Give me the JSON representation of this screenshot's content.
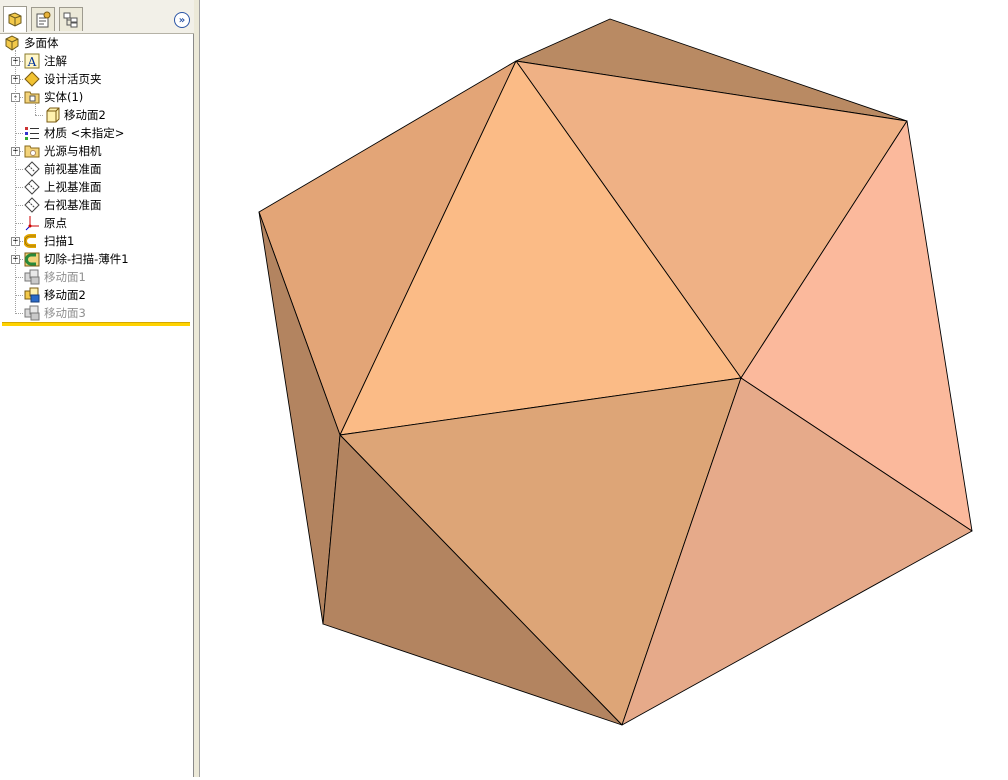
{
  "feature_tree": {
    "tabs": [
      {
        "name": "featuremanager-tab-icon",
        "active": true
      },
      {
        "name": "propertymanager-tab-icon",
        "active": false
      },
      {
        "name": "configurationmanager-tab-icon",
        "active": false
      }
    ],
    "expand_button": "»",
    "items": [
      {
        "label": "多面体",
        "icon": "part-icon",
        "level": 0,
        "expander": "",
        "dim": false
      },
      {
        "label": "注解",
        "icon": "annotations-icon",
        "level": 1,
        "expander": "+",
        "dim": false
      },
      {
        "label": "设计活页夹",
        "icon": "design-binder-icon",
        "level": 1,
        "expander": "+",
        "dim": false
      },
      {
        "label": "实体(1)",
        "icon": "solid-bodies-icon",
        "level": 1,
        "expander": "-",
        "dim": false
      },
      {
        "label": "移动面2",
        "icon": "body-icon",
        "level": 2,
        "expander": "",
        "dim": false
      },
      {
        "label": "材质 <未指定>",
        "icon": "material-icon",
        "level": 1,
        "expander": "",
        "dim": false
      },
      {
        "label": "光源与相机",
        "icon": "lights-cameras-icon",
        "level": 1,
        "expander": "+",
        "dim": false
      },
      {
        "label": "前视基准面",
        "icon": "plane-icon",
        "level": 1,
        "expander": "",
        "dim": false
      },
      {
        "label": "上视基准面",
        "icon": "plane-icon",
        "level": 1,
        "expander": "",
        "dim": false
      },
      {
        "label": "右视基准面",
        "icon": "plane-icon",
        "level": 1,
        "expander": "",
        "dim": false
      },
      {
        "label": "原点",
        "icon": "origin-icon",
        "level": 1,
        "expander": "",
        "dim": false
      },
      {
        "label": "扫描1",
        "icon": "sweep-icon",
        "level": 1,
        "expander": "+",
        "dim": false
      },
      {
        "label": "切除-扫描-薄件1",
        "icon": "cut-sweep-icon",
        "level": 1,
        "expander": "+",
        "dim": false
      },
      {
        "label": "移动面1",
        "icon": "move-face-icon",
        "level": 1,
        "expander": "",
        "dim": true
      },
      {
        "label": "移动面2",
        "icon": "move-face-icon",
        "level": 1,
        "expander": "",
        "dim": false
      },
      {
        "label": "移动面3",
        "icon": "move-face-icon",
        "level": 1,
        "expander": "",
        "dim": true
      }
    ]
  },
  "colors": {
    "edge": "#000000",
    "faces": [
      "#b98a63",
      "#efb185",
      "#e3a577",
      "#fbbb86",
      "#fbb99c",
      "#dda577",
      "#b38460",
      "#e6aa8a"
    ]
  }
}
